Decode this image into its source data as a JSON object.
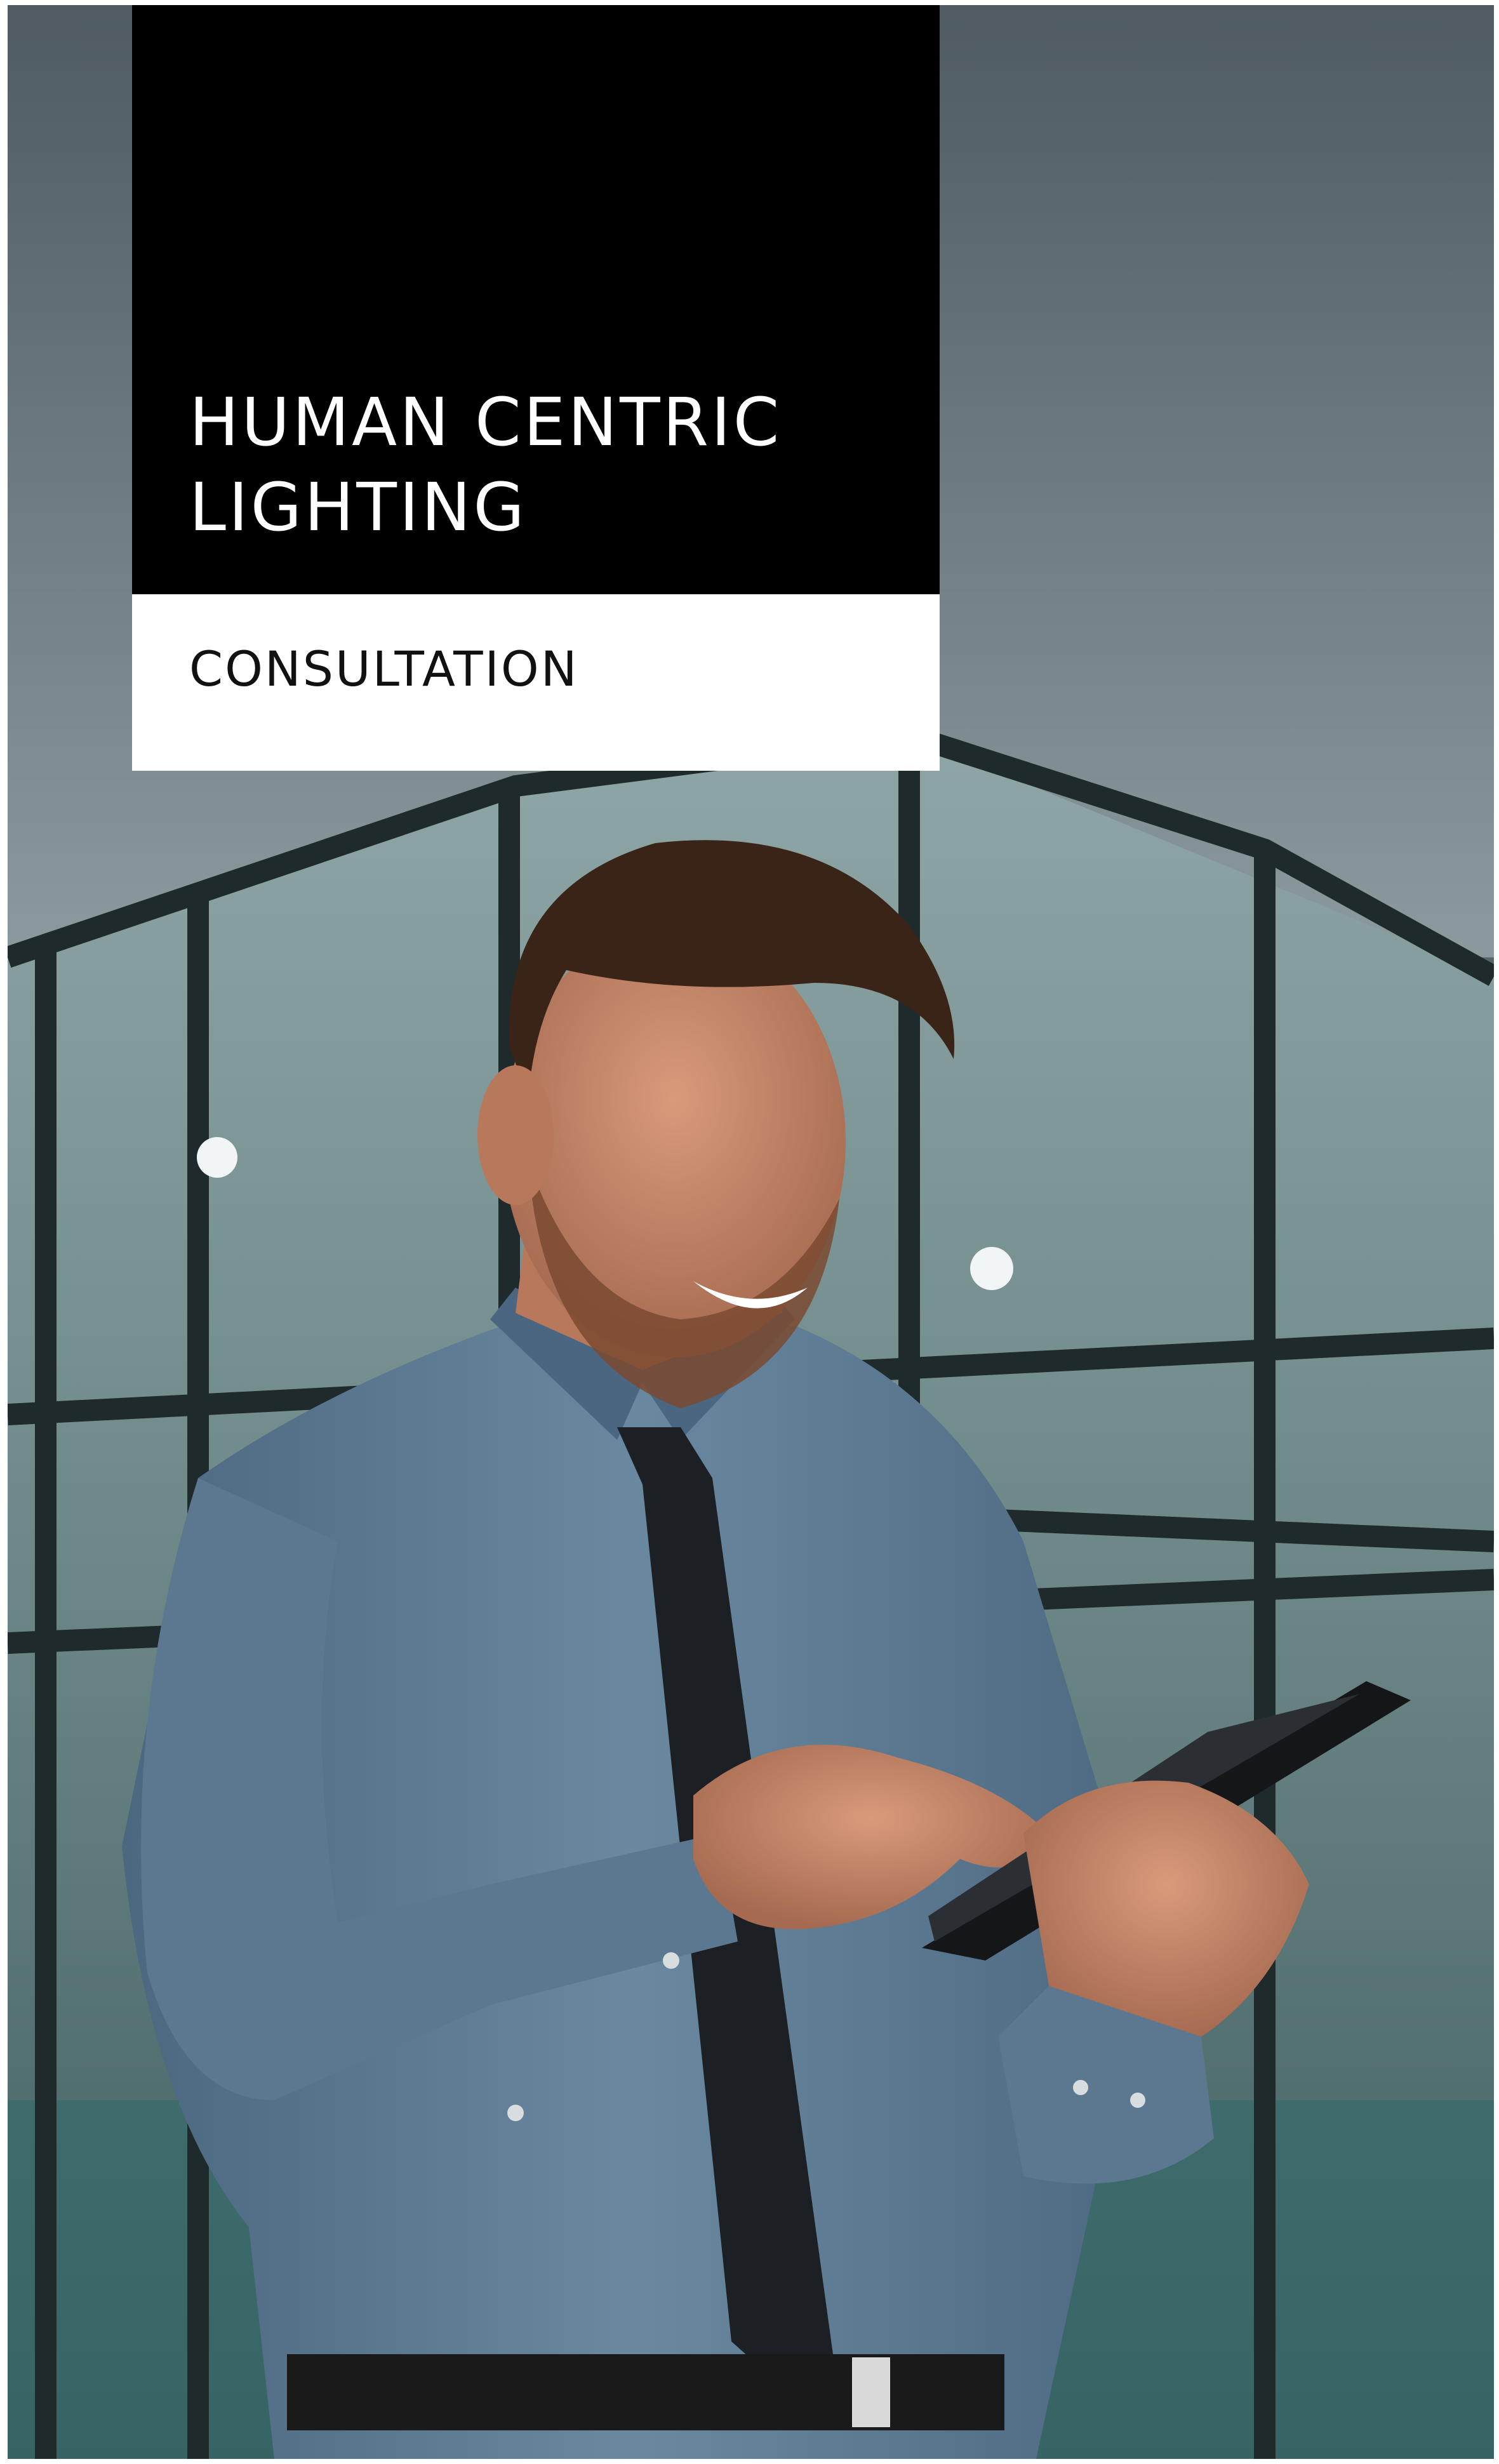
{
  "cover": {
    "title": "HUMAN CENTRIC LIGHTING",
    "subtitle": "CONSULTATION"
  },
  "photo": {
    "subject": "man-with-tablet-photo"
  },
  "colors": {
    "title_box": "#000000",
    "title_text": "#ffffff",
    "subtitle_box": "#ffffff",
    "subtitle_text": "#111111",
    "shirt": "#5b7890",
    "glass": "#6f8a8a",
    "frames": "#1f2a2d"
  }
}
